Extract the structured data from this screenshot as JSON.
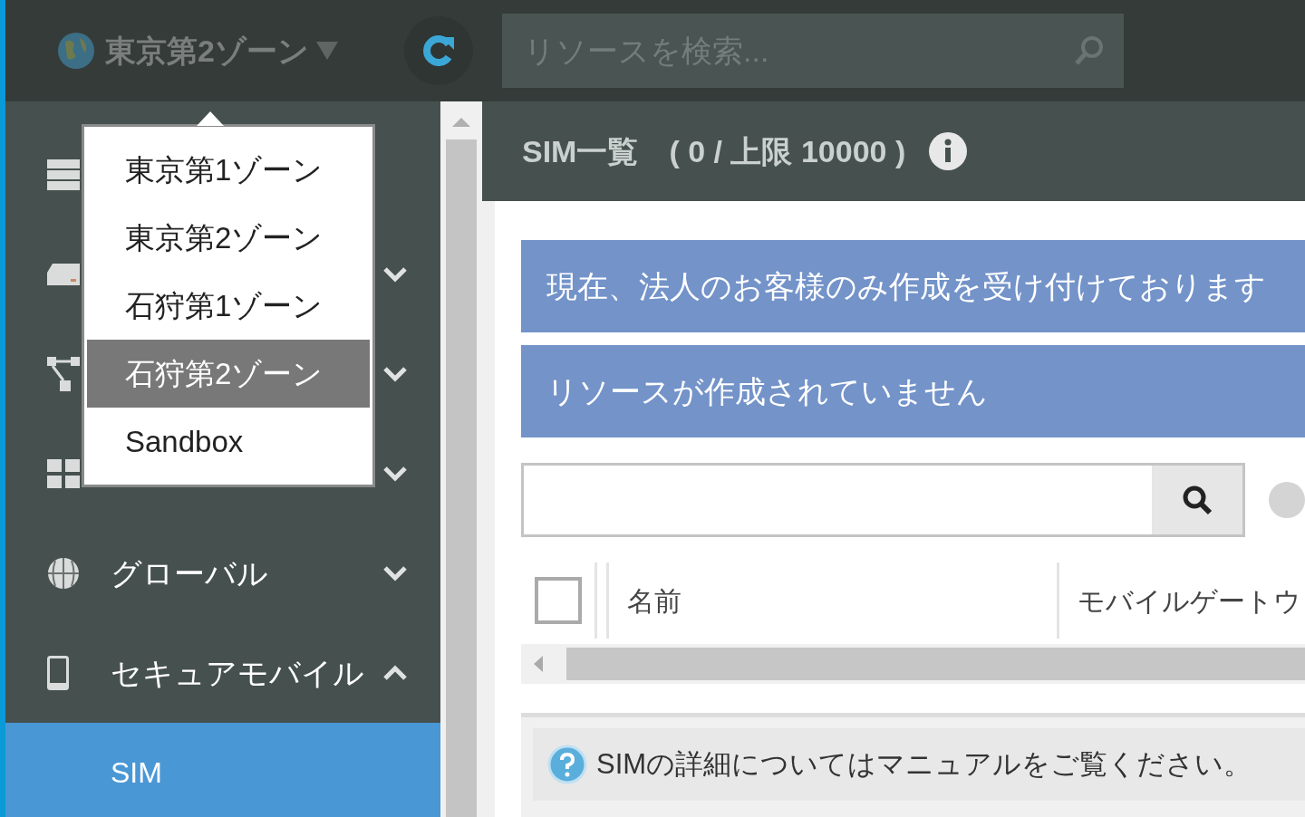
{
  "topbar": {
    "zone": "東京第2ゾーン",
    "search": {
      "placeholder": "リソースを検索..."
    }
  },
  "zone_menu": {
    "items": [
      {
        "label": "東京第1ゾーン",
        "selected": false
      },
      {
        "label": "東京第2ゾーン",
        "selected": false
      },
      {
        "label": "石狩第1ゾーン",
        "selected": false
      },
      {
        "label": "石狩第2ゾーン",
        "selected": true
      },
      {
        "label": "Sandbox",
        "selected": false
      }
    ]
  },
  "sidebar": {
    "items": [
      {
        "kind": "servers"
      },
      {
        "kind": "disk",
        "expanded": false
      },
      {
        "kind": "network",
        "expanded": false
      },
      {
        "kind": "grid",
        "expanded": false
      },
      {
        "kind": "globe",
        "label": "グローバル",
        "expanded": false
      },
      {
        "kind": "mobile",
        "label": "セキュアモバイル",
        "expanded": true,
        "children": [
          {
            "label": "SIM",
            "selected": true
          }
        ]
      }
    ]
  },
  "main": {
    "title": "SIM一覧　( 0 / 上限 10000 )",
    "alerts": [
      "現在、法人のお客様のみ作成を受け付けております",
      "リソースが作成されていません"
    ],
    "table": {
      "select_all": {
        "checked": false
      },
      "columns": [
        "名前",
        "モバイルゲートウ"
      ]
    },
    "help": "SIMの詳細についてはマニュアルをご覧ください。"
  }
}
